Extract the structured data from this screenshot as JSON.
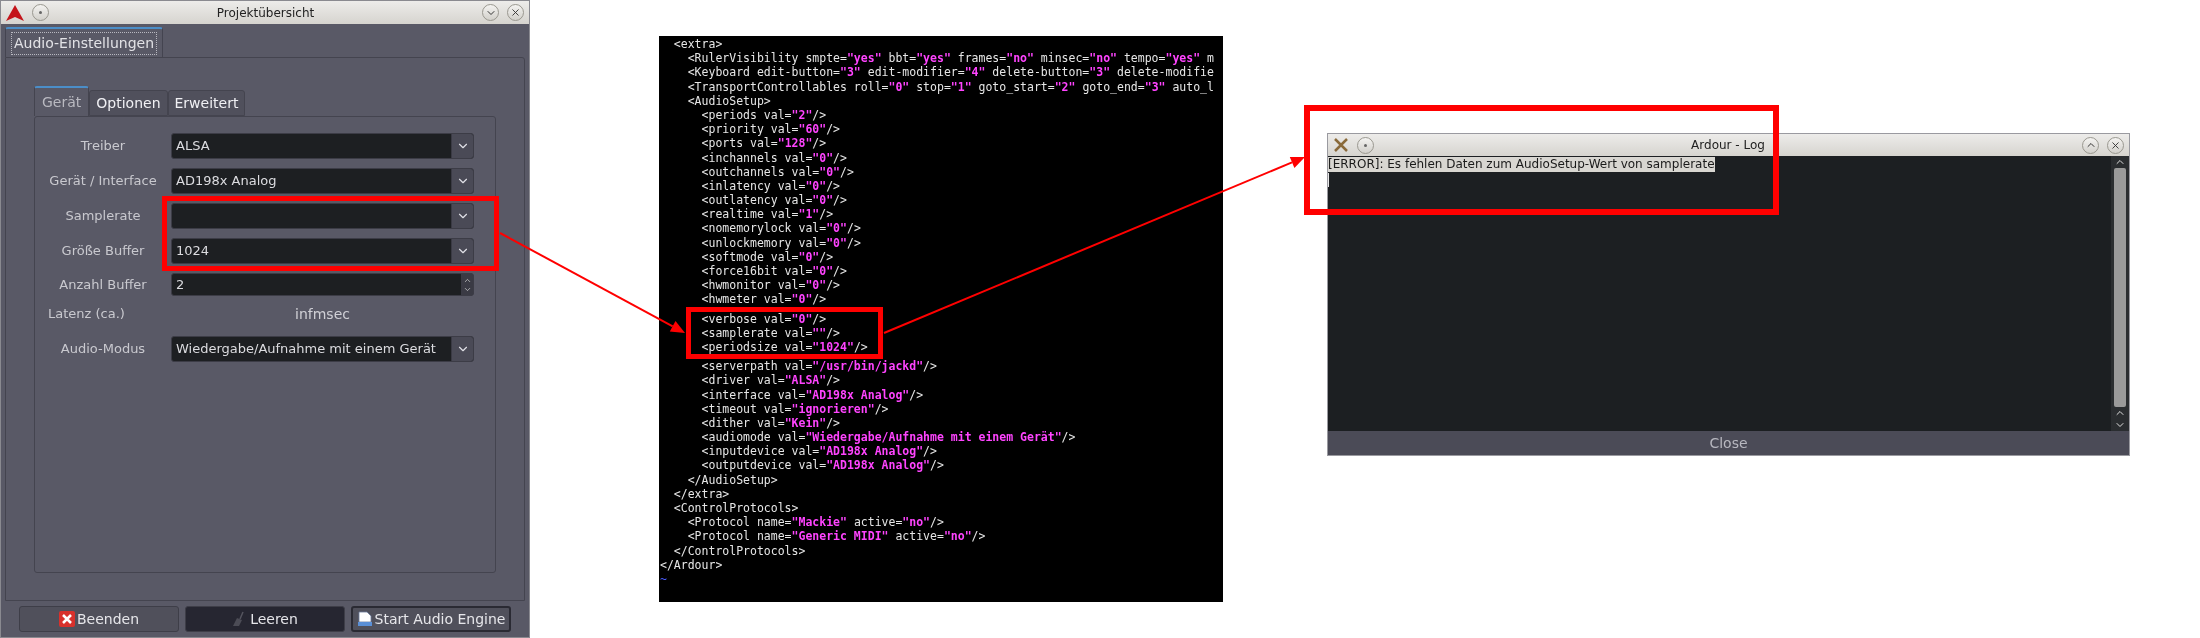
{
  "session_window": {
    "title": "Projektübersicht",
    "outer_tabs": [
      {
        "label": "Audio-Einstellungen",
        "selected": true
      }
    ],
    "inner_tabs": [
      {
        "label": "Gerät",
        "selected": true
      },
      {
        "label": "Optionen",
        "selected": false
      },
      {
        "label": "Erweitert",
        "selected": false
      }
    ],
    "rows": [
      {
        "label": "Treiber",
        "kind": "combo",
        "value": "ALSA"
      },
      {
        "label": "Gerät / Interface",
        "kind": "combo",
        "value": "AD198x Analog"
      },
      {
        "label": "Samplerate",
        "kind": "combo"
      },
      {
        "label": "Größe Buffer",
        "kind": "combo",
        "value": "1024"
      },
      {
        "label": "Anzahl Buffer",
        "kind": "spin",
        "value": "2"
      },
      {
        "label": "Latenz (ca.)",
        "kind": "readout",
        "value": "infmsec"
      },
      {
        "label": "Audio-Modus",
        "kind": "combo",
        "value": "Wiedergabe/Aufnahme mit einem Gerät"
      }
    ],
    "buttons": [
      {
        "label": "Beenden",
        "kind": "quit",
        "pressed": false,
        "focused": false
      },
      {
        "label": "Leeren",
        "kind": "clear",
        "pressed": true,
        "focused": false
      },
      {
        "label": "Start Audio Engine",
        "kind": "start",
        "pressed": false,
        "focused": true
      }
    ]
  },
  "terminal": {
    "lines": [
      "  <extra>",
      "    <RulerVisibility smpte=**\"yes\"** bbt=**\"yes\"** frames=**\"no\"** minsec=**\"no\"** tempo=**\"yes\"** m",
      "    <Keyboard edit-button=**\"3\"** edit-modifier=**\"4\"** delete-button=**\"3\"** delete-modifie",
      "    <TransportControllables roll=**\"0\"** stop=**\"1\"** goto_start=**\"2\"** goto_end=**\"3\"** auto_l",
      "    <AudioSetup>",
      "      <periods val=**\"2\"**/>",
      "      <priority val=**\"60\"**/>",
      "      <ports val=**\"128\"**/>",
      "      <inchannels val=**\"0\"**/>",
      "      <outchannels val=**\"0\"**/>",
      "      <inlatency val=**\"0\"**/>",
      "      <outlatency val=**\"0\"**/>",
      "      <realtime val=**\"1\"**/>",
      "      <nomemorylock val=**\"0\"**/>",
      "      <unlockmemory val=**\"0\"**/>",
      "      <softmode val=**\"0\"**/>",
      "      <force16bit val=**\"0\"**/>",
      "      <hwmonitor val=**\"0\"**/>",
      "      <hwmeter val=**\"0\"**/>",
      "      <verbose val=**\"0\"**/>",
      "      <samplerate val=**\"\"**/>",
      "      <periodsize val=**\"1024\"**/>",
      "      <serverpath val=**\"/usr/bin/jackd\"**/>",
      "      <driver val=**\"ALSA\"**/>",
      "      <interface val=**\"AD198x Analog\"**/>",
      "      <timeout val=**\"ignorieren\"**/>",
      "      <dither val=**\"Kein\"**/>",
      "      <audiomode val=**\"Wiedergabe/Aufnahme mit einem Gerät\"**/>",
      "      <inputdevice val=**\"AD198x Analog\"**/>",
      "      <outputdevice val=**\"AD198x Analog\"**/>",
      "    </AudioSetup>",
      "  </extra>",
      "  <ControlProtocols>",
      "    <Protocol name=**\"Mackie\"** active=**\"no\"**/>",
      "    <Protocol name=**\"Generic MIDI\"** active=**\"no\"**/>",
      "  </ControlProtocols>",
      "</Ardour>"
    ],
    "empty_line_marker": "~"
  },
  "log_window": {
    "title": "Ardour - Log",
    "lines": [
      {
        "text": "[ERROR]: Es fehlen Daten zum AudioSetup-Wert von samplerate",
        "selected": true
      }
    ],
    "close_button": "Close"
  }
}
